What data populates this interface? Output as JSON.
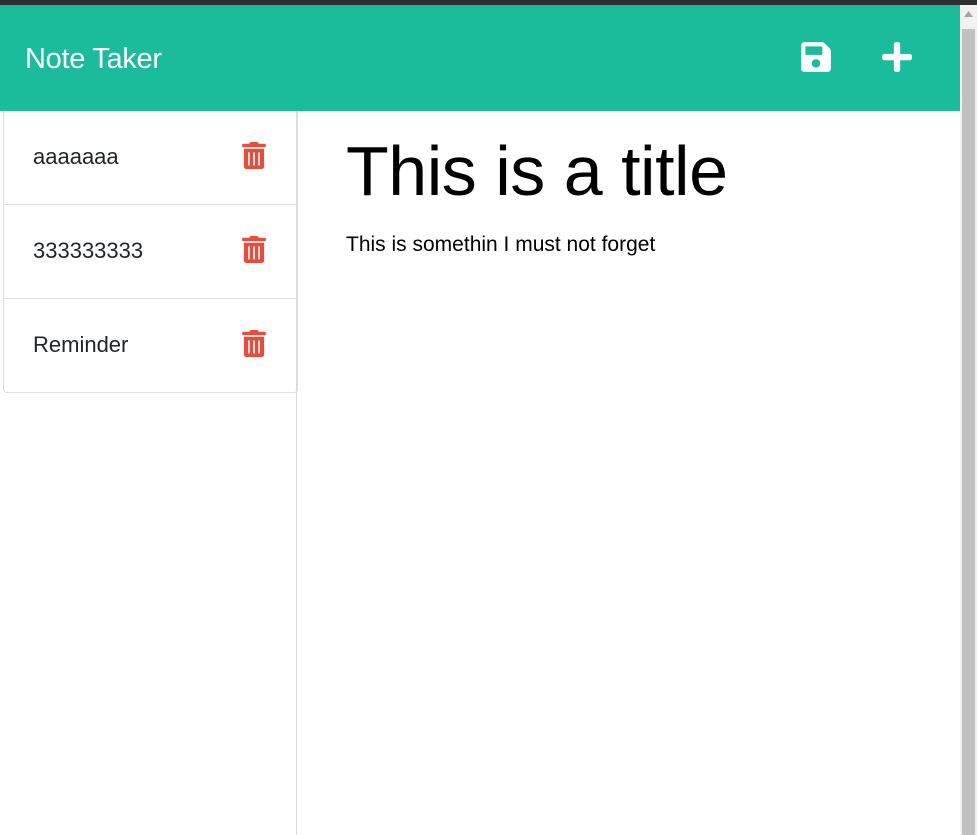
{
  "app": {
    "title": "Note Taker"
  },
  "toolbar": {
    "save_icon": "save-icon",
    "new_icon": "plus-icon",
    "icon_color": "#ffffff",
    "bar_color": "#1abc9c"
  },
  "sidebar": {
    "notes": [
      {
        "title": "aaaaaaa",
        "delete_icon": "trash-icon"
      },
      {
        "title": "333333333",
        "delete_icon": "trash-icon"
      },
      {
        "title": "Reminder",
        "delete_icon": "trash-icon"
      }
    ],
    "delete_color": "#e74c3c"
  },
  "editor": {
    "title": "This is a title",
    "body": "This is somethin I must not forget"
  }
}
